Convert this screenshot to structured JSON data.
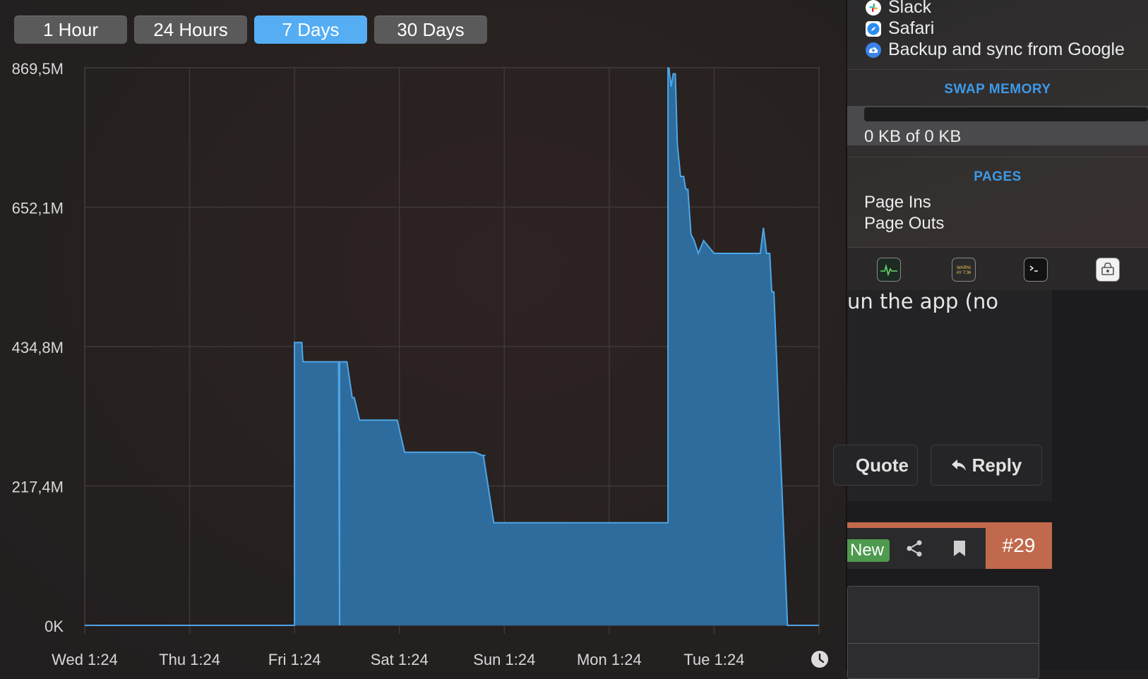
{
  "range_buttons": [
    {
      "label": "1 Hour",
      "active": false
    },
    {
      "label": "24 Hours",
      "active": false
    },
    {
      "label": "7 Days",
      "active": true
    },
    {
      "label": "30 Days",
      "active": false
    }
  ],
  "chart_data": {
    "type": "area",
    "ylabel": "",
    "xlabel": "",
    "y_ticks": [
      "869,5M",
      "652,1M",
      "434,8M",
      "217,4M",
      "0K"
    ],
    "y_tick_values_mb": [
      869.5,
      652.1,
      434.8,
      217.4,
      0
    ],
    "x_ticks": [
      "Wed 1:24",
      "Thu 1:24",
      "Fri 1:24",
      "Sat 1:24",
      "Sun 1:24",
      "Mon 1:24",
      "Tue 1:24"
    ],
    "x_tick_values_days": [
      0,
      1,
      2,
      3,
      4,
      5,
      6
    ],
    "xlim_days": [
      0,
      7
    ],
    "ylim_mb": [
      0,
      869.5
    ],
    "grid": true,
    "color": "#2e6c9e",
    "line_color": "#4ea6e6",
    "x_days": [
      0.0,
      2.0,
      2.0,
      2.07,
      2.08,
      2.42,
      2.43,
      2.43,
      2.5,
      2.55,
      2.57,
      2.62,
      2.67,
      2.7,
      2.79,
      2.82,
      2.9,
      2.98,
      3.05,
      3.1,
      3.15,
      3.2,
      3.25,
      3.34,
      3.45,
      3.55,
      3.65,
      3.72,
      3.79,
      3.82,
      3.8,
      3.9,
      4.0,
      4.2,
      4.4,
      4.6,
      4.7,
      4.8,
      4.95,
      5.0,
      5.1,
      5.2,
      5.45,
      5.56,
      5.56,
      5.57,
      5.59,
      5.61,
      5.63,
      5.65,
      5.68,
      5.71,
      5.73,
      5.75,
      5.78,
      5.81,
      5.85,
      5.9,
      6.0,
      6.1,
      6.2,
      6.28,
      6.29,
      6.31,
      6.34,
      6.37,
      6.4,
      6.44,
      6.47,
      6.5,
      6.53,
      6.55,
      6.57,
      6.7,
      6.8,
      6.9,
      7.0
    ],
    "y_mb": [
      0,
      0,
      441,
      441,
      411,
      411,
      0,
      411,
      411,
      355,
      355,
      320,
      320,
      320,
      320,
      320,
      320,
      320,
      270,
      270,
      270,
      270,
      270,
      270,
      270,
      270,
      270,
      270,
      265,
      265,
      265,
      160,
      160,
      160,
      160,
      160,
      160,
      160,
      160,
      160,
      160,
      160,
      160,
      160,
      869,
      869,
      840,
      860,
      860,
      750,
      700,
      700,
      680,
      680,
      610,
      600,
      580,
      600,
      580,
      580,
      580,
      580,
      580,
      580,
      580,
      580,
      580,
      580,
      620,
      580,
      580,
      520,
      520,
      0,
      0,
      0,
      0
    ]
  },
  "popover": {
    "apps": [
      {
        "name": "Slack",
        "icon": "slack-icon"
      },
      {
        "name": "Safari",
        "icon": "safari-icon"
      },
      {
        "name": "Backup and sync from Google",
        "icon": "google-backup-icon"
      }
    ],
    "swap_title": "SWAP MEMORY",
    "swap_text": "0 KB of 0 KB",
    "swap_fraction": 0,
    "pages_title": "PAGES",
    "page_rows": [
      "Page Ins",
      "Page Outs"
    ],
    "toolbar_icons": [
      "activity-monitor-icon",
      "console-icon",
      "terminal-icon",
      "system-information-icon"
    ],
    "toolbar_console_text": "WARNI\nAY 7:36"
  },
  "forum": {
    "post_text": "un the app (no",
    "quote_label": "Quote",
    "reply_label": "Reply",
    "new_label": "New",
    "post_number": "#29"
  }
}
